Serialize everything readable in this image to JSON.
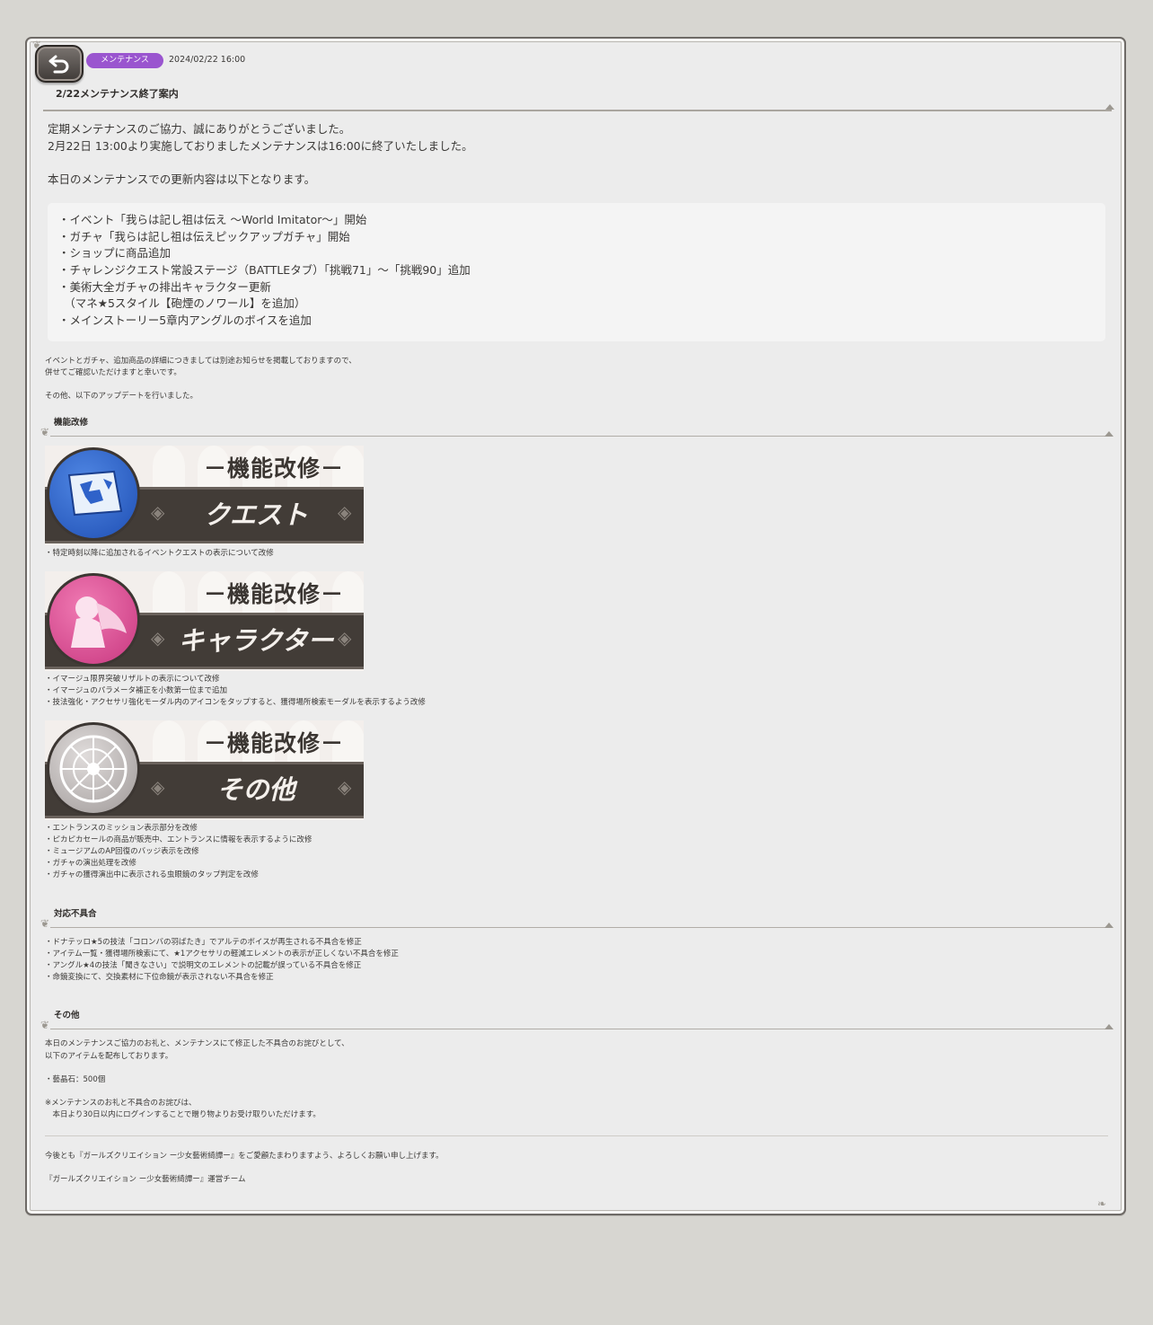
{
  "header": {
    "category_badge": "メンテナンス",
    "date": "2024/02/22 16:00",
    "title": "2/22メンテナンス終了案内"
  },
  "intro": [
    "定期メンテナンスのご協力、誠にありがとうございました。",
    "2月22日 13:00より実施しておりましたメンテナンスは16:00に終了いたしました。",
    "本日のメンテナンスでの更新内容は以下となります。"
  ],
  "update_list": [
    "・イベント「我らは記し祖は伝え 〜World Imitator〜」開始",
    "・ガチャ「我らは記し祖は伝えピックアップガチャ」開始",
    "・ショップに商品追加",
    "・チャレンジクエスト常設ステージ（BATTLEタブ）「挑戦71」〜「挑戦90」追加",
    "・美術大全ガチャの排出キャラクター更新",
    "　（マネ★5スタイル【砲煙のノワール】を追加）",
    "・メインストーリー5章内アングルのボイスを追加"
  ],
  "notes": [
    "イベントとガチャ、追加商品の詳細につきましては別途お知らせを掲載しておりますので、",
    "併せてご確認いただけますと幸いです。",
    "その他、以下のアップデートを行いました。"
  ],
  "section_improvements": {
    "heading": "機能改修",
    "banners": [
      {
        "top": "－機能改修－",
        "bottom": "クエスト",
        "icon": "map-icon",
        "color": "#2f62c9"
      },
      {
        "top": "－機能改修－",
        "bottom": "キャラクター",
        "icon": "character-silhouette-icon",
        "color": "#d94b92"
      },
      {
        "top": "－機能改修－",
        "bottom": "その他",
        "icon": "rose-window-icon",
        "color": "#b9b4b3"
      }
    ],
    "quest_items": [
      "・特定時刻以降に追加されるイベントクエストの表示について改修"
    ],
    "character_items": [
      "・イマージュ限界突破リザルトの表示について改修",
      "・イマージュのパラメータ補正を小数第一位まで追加",
      "・技法強化・アクセサリ強化モーダル内のアイコンをタップすると、獲得場所検索モーダルを表示するよう改修"
    ],
    "other_items": [
      "・エントランスのミッション表示部分を改修",
      "・ピカピカセールの商品が販売中、エントランスに情報を表示するように改修",
      "・ミュージアムのAP回復のバッジ表示を改修",
      "・ガチャの演出処理を改修",
      "・ガチャの獲得演出中に表示される虫眼鏡のタップ判定を改修"
    ]
  },
  "section_bugs": {
    "heading": "対応不具合",
    "items": [
      "・ドナテッロ★5の技法「コロンバの羽ばたき」でアルテのボイスが再生される不具合を修正",
      "・アイテム一覧・獲得場所検索にて、★1アクセサリの軽減エレメントの表示が正しくない不具合を修正",
      "・アングル★4の技法「聞きなさい」で説明文のエレメントの記載が誤っている不具合を修正",
      "・命鏡変換にて、交換素材に下位命鏡が表示されない不具合を修正"
    ]
  },
  "section_other": {
    "heading": "その他",
    "lines": [
      "本日のメンテナンスご協力のお礼と、メンテナンスにて修正した不具合のお詫びとして、",
      "以下のアイテムを配布しております。",
      "・藝晶石：500個",
      "※メンテナンスのお礼と不具合のお詫びは、",
      "　本日より30日以内にログインすることで贈り物よりお受け取りいただけます。"
    ]
  },
  "footer": [
    "今後とも『ガールズクリエイション ー少女藝術綺譚ー』をご愛顧たまわりますよう、よろしくお願い申し上げます。",
    "『ガールズクリエイション ー少女藝術綺譚ー』運営チーム"
  ]
}
